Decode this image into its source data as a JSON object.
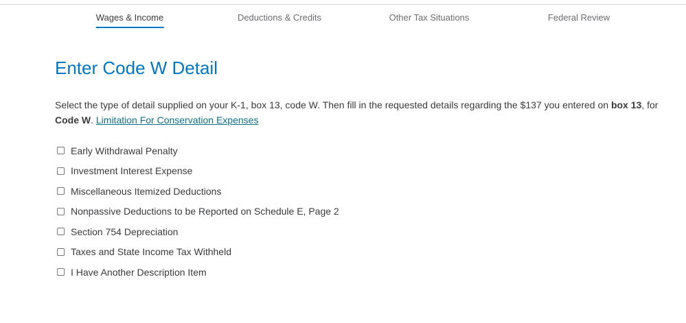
{
  "nav": {
    "tabs": [
      {
        "label": "Wages & Income",
        "active": true
      },
      {
        "label": "Deductions & Credits",
        "active": false
      },
      {
        "label": "Other Tax Situations",
        "active": false
      },
      {
        "label": "Federal Review",
        "active": false
      }
    ]
  },
  "page": {
    "title": "Enter Code W Detail",
    "intro": {
      "part1": "Select the type of detail supplied on your K-1, box 13, code W. Then fill in the requested details regarding the $137 you entered on ",
      "bold1": "box 13",
      "part2": ", for ",
      "bold2": "Code W",
      "part3": ". ",
      "link": "Limitation For Conservation Expenses"
    }
  },
  "options": [
    {
      "label": "Early Withdrawal Penalty",
      "checked": false
    },
    {
      "label": "Investment Interest Expense",
      "checked": false
    },
    {
      "label": "Miscellaneous Itemized Deductions",
      "checked": false
    },
    {
      "label": "Nonpassive Deductions to be Reported on Schedule E, Page 2",
      "checked": false
    },
    {
      "label": "Section 754 Depreciation",
      "checked": false
    },
    {
      "label": "Taxes and State Income Tax Withheld",
      "checked": false
    },
    {
      "label": "I Have Another Description Item",
      "checked": false
    }
  ],
  "colors": {
    "accent": "#0077c5",
    "link": "#0d7287",
    "text": "#393a3d",
    "muted": "#6b6c72"
  }
}
